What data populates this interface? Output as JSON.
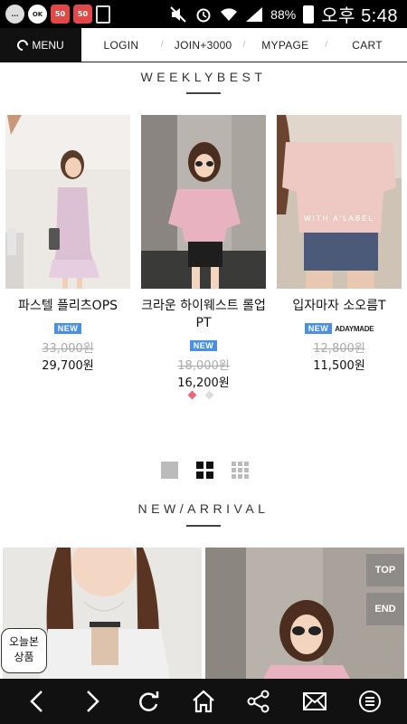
{
  "status_bar": {
    "notifications": [
      "…",
      "OK",
      "50",
      "50",
      ""
    ],
    "battery": "88%",
    "ampm": "오후",
    "time": "5:48"
  },
  "nav": {
    "menu_label": "MENU",
    "links": [
      "LOGIN",
      "JOIN+3000",
      "MYPAGE",
      "CART"
    ]
  },
  "weekly_best": {
    "title": "WEEKLYBEST",
    "products": [
      {
        "name": "파스텔 플리츠OPS",
        "badge": "NEW",
        "brand": "",
        "old_price": "33,000원",
        "price": "29,700원"
      },
      {
        "name": "크라운 하이웨스트 롤업PT",
        "badge": "NEW",
        "brand": "",
        "old_price": "18,000원",
        "price": "16,200원"
      },
      {
        "name": "입자마자 소오름T",
        "badge": "NEW",
        "brand": "ADAYMADE",
        "old_price": "12,800원",
        "price": "11,500원"
      }
    ],
    "image_overlay_text": "WITH A'LABEL"
  },
  "new_arrival": {
    "title": "NEW/ARRIVAL"
  },
  "floating": {
    "top": "TOP",
    "end": "END",
    "today_line1": "오늘본",
    "today_line2": "상품"
  },
  "colors": {
    "accent_blue": "#4a90e2",
    "dot_active": "#e86a7a",
    "nav_black": "#111111"
  },
  "bottom_icons": [
    "back-icon",
    "forward-icon",
    "refresh-icon",
    "home-icon",
    "share-icon",
    "mail-icon",
    "menu-circle-icon"
  ]
}
